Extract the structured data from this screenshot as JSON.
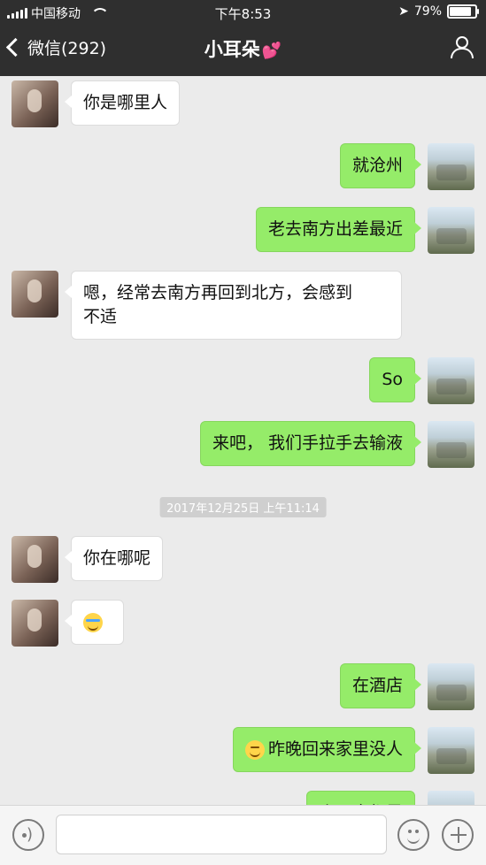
{
  "status": {
    "carrier": "中国移动",
    "time": "下午8:53",
    "battery": "79%",
    "battery_level": 0.79
  },
  "nav": {
    "back_label": "微信(292)",
    "title": "小耳朵",
    "title_emoji": "💕"
  },
  "messages": [
    {
      "side": "left",
      "text": "你是哪里人"
    },
    {
      "side": "right",
      "text": "就沧州"
    },
    {
      "side": "right",
      "text": "老去南方出差最近"
    },
    {
      "side": "left",
      "text": "嗯，经常去南方再回到北方，会感到\n不适"
    },
    {
      "side": "right",
      "text": "So"
    },
    {
      "side": "right",
      "text": "来吧， 我们手拉手去输液"
    },
    {
      "side": "left",
      "text": "你在哪呢"
    },
    {
      "side": "left",
      "text": "",
      "emoji": "crying-laughing"
    },
    {
      "side": "right",
      "text": "在酒店"
    },
    {
      "side": "right",
      "text": "昨晚回来家里没人",
      "emoji": "smile"
    },
    {
      "side": "right",
      "text": "小区全都黑"
    }
  ],
  "timestamp": "2017年12月25日 上午11:14",
  "composer": {
    "voice_icon": "voice-icon",
    "emoji_icon": "emoji-icon",
    "plus_icon": "plus-icon"
  }
}
